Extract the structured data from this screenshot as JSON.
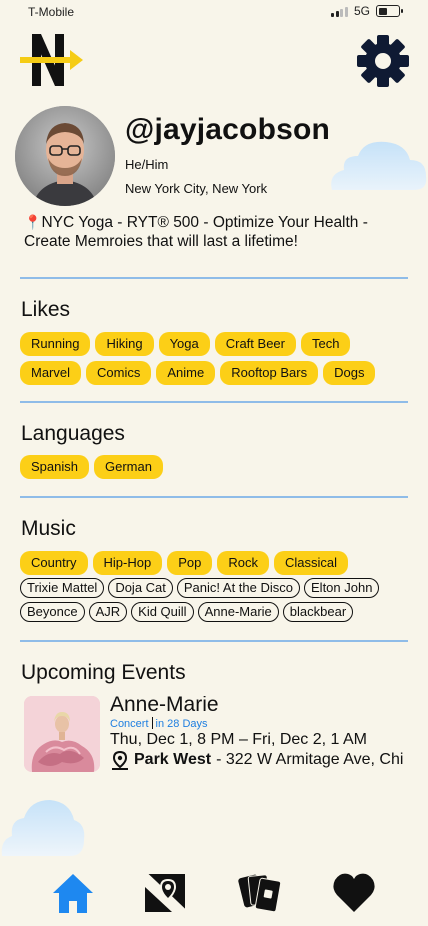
{
  "status": {
    "carrier": "T-Mobile",
    "network": "5G"
  },
  "profile": {
    "username": "@jayjacobson",
    "pronouns": "He/Him",
    "location": "New York City, New York",
    "bio": "NYC Yoga - RYT® 500 - Optimize Your Health - Create Memroies that will last a lifetime!"
  },
  "sections": {
    "likes": {
      "title": "Likes",
      "items": [
        "Running",
        "Hiking",
        "Yoga",
        "Craft Beer",
        "Tech",
        "Marvel",
        "Comics",
        "Anime",
        "Rooftop Bars",
        "Dogs"
      ]
    },
    "languages": {
      "title": "Languages",
      "items": [
        "Spanish",
        "German"
      ]
    },
    "music": {
      "title": "Music",
      "genres": [
        "Country",
        "Hip-Hop",
        "Pop",
        "Rock",
        "Classical"
      ],
      "artists": [
        "Trixie Mattel",
        "Doja Cat",
        "Panic! At the Disco",
        "Elton John",
        "Beyonce",
        "AJR",
        "Kid Quill",
        "Anne-Marie",
        "blackbear"
      ]
    },
    "events": {
      "title": "Upcoming Events",
      "items": [
        {
          "name": "Anne-Marie",
          "category": "Concert",
          "countdown": "in 28 Days",
          "dates": "Thu, Dec 1, 8 PM – Fri, Dec 2, 1 AM",
          "venue": "Park West",
          "address": "- 322 W Armitage Ave, Chi"
        }
      ]
    }
  },
  "tabs": [
    {
      "icon": "home-icon",
      "active": true
    },
    {
      "icon": "map-pin-icon",
      "active": false
    },
    {
      "icon": "cards-icon",
      "active": false
    },
    {
      "icon": "heart-icon",
      "active": false
    }
  ],
  "colors": {
    "background": "#f8f5ea",
    "chip": "#fccf17",
    "divider": "#8fbce8",
    "accent": "#1f7fe0",
    "active_tab": "#1e88f0"
  }
}
